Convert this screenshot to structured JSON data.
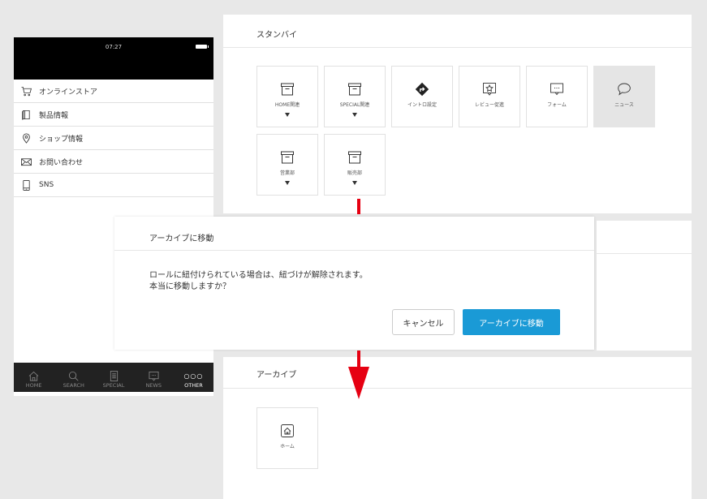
{
  "phone": {
    "time": "07:27",
    "menu": [
      {
        "label": "オンラインストア",
        "icon": "cart-icon"
      },
      {
        "label": "製品情報",
        "icon": "book-icon"
      },
      {
        "label": "ショップ情報",
        "icon": "map-pin-icon"
      },
      {
        "label": "お問い合わせ",
        "icon": "mail-icon"
      },
      {
        "label": "SNS",
        "icon": "smartphone-icon"
      }
    ],
    "tabs": [
      {
        "label": "HOME",
        "icon": "home-icon",
        "active": false
      },
      {
        "label": "SEARCH",
        "icon": "search-icon",
        "active": false
      },
      {
        "label": "SPECIAL",
        "icon": "document-icon",
        "active": false
      },
      {
        "label": "NEWS",
        "icon": "chat-icon",
        "active": false
      },
      {
        "label": "OTHER",
        "icon": "more-icon",
        "active": true
      }
    ],
    "tab_more_dots": "○○○"
  },
  "standby": {
    "title": "スタンバイ",
    "tiles": [
      {
        "label": "HOME関連",
        "icon": "archive-box-icon",
        "has_caret": true
      },
      {
        "label": "SPECIAL関連",
        "icon": "archive-box-icon",
        "has_caret": true
      },
      {
        "label": "イントロ設定",
        "icon": "direction-sign-icon",
        "has_caret": false
      },
      {
        "label": "レビュー促進",
        "icon": "star-review-icon",
        "has_caret": false
      },
      {
        "label": "フォーム",
        "icon": "form-chat-icon",
        "has_caret": false
      },
      {
        "label": "ニュース",
        "icon": "speech-bubble-icon",
        "has_caret": false,
        "selected": true
      },
      {
        "label": "営業部",
        "icon": "archive-box-icon",
        "has_caret": true
      },
      {
        "label": "販売部",
        "icon": "archive-box-icon",
        "has_caret": true
      }
    ]
  },
  "dialog": {
    "title": "アーカイブに移動",
    "message_line1": "ロールに紐付けられている場合は、紐づけが解除されます。",
    "message_line2": "本当に移動しますか？",
    "cancel_label": "キャンセル",
    "confirm_label": "アーカイブに移動"
  },
  "archive": {
    "title": "アーカイブ",
    "tiles": [
      {
        "label": "ホーム",
        "icon": "home-puzzle-icon"
      }
    ]
  },
  "colors": {
    "primary_button": "#1a9ad6",
    "arrow": "#e60012",
    "background": "#e8e8e8",
    "phone_tabbar": "#222222"
  }
}
